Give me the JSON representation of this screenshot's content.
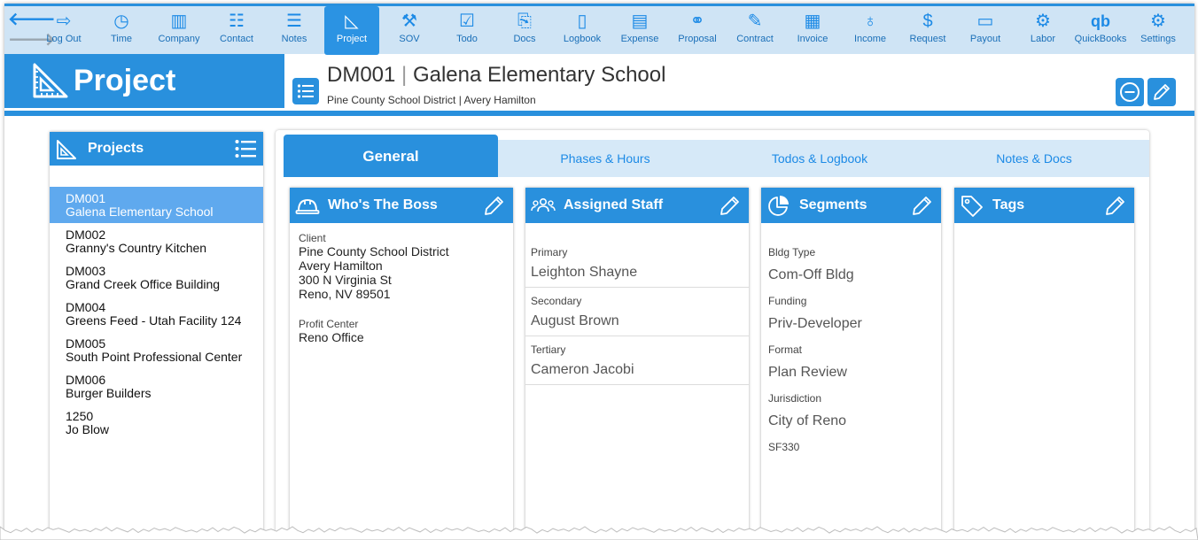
{
  "toolbar": {
    "items": [
      {
        "label": "Log Out",
        "icon": "log-out-icon",
        "glyph": "⇨"
      },
      {
        "label": "Time",
        "icon": "clock-icon",
        "glyph": "◷"
      },
      {
        "label": "Company",
        "icon": "building-icon",
        "glyph": "▥"
      },
      {
        "label": "Contact",
        "icon": "contact-card-icon",
        "glyph": "☷"
      },
      {
        "label": "Notes",
        "icon": "notes-icon",
        "glyph": "☰"
      },
      {
        "label": "Project",
        "icon": "triangle-ruler-icon",
        "glyph": "◺"
      },
      {
        "label": "SOV",
        "icon": "hammer-icon",
        "glyph": "⚒"
      },
      {
        "label": "Todo",
        "icon": "checklist-icon",
        "glyph": "☑"
      },
      {
        "label": "Docs",
        "icon": "documents-icon",
        "glyph": "⎘"
      },
      {
        "label": "Logbook",
        "icon": "logbook-icon",
        "glyph": "▯"
      },
      {
        "label": "Expense",
        "icon": "receipt-icon",
        "glyph": "▤"
      },
      {
        "label": "Proposal",
        "icon": "handshake-icon",
        "glyph": "⚭"
      },
      {
        "label": "Contract",
        "icon": "pen-icon",
        "glyph": "✎"
      },
      {
        "label": "Invoice",
        "icon": "invoice-icon",
        "glyph": "▦"
      },
      {
        "label": "Income",
        "icon": "piggy-bank-icon",
        "glyph": "♁"
      },
      {
        "label": "Request",
        "icon": "dollar-doc-icon",
        "glyph": "$"
      },
      {
        "label": "Payout",
        "icon": "check-icon",
        "glyph": "▭"
      },
      {
        "label": "Labor",
        "icon": "worker-icon",
        "glyph": "⚙"
      },
      {
        "label": "QuickBooks",
        "icon": "quickbooks-icon",
        "glyph": "qb"
      },
      {
        "label": "Settings",
        "icon": "gears-icon",
        "glyph": "⚙"
      }
    ],
    "active": "Project"
  },
  "brand": {
    "title": "Project",
    "icon": "triangle-ruler-icon"
  },
  "header": {
    "code": "DM001",
    "separator": "|",
    "name": "Galena Elementary School",
    "subtitle": "Pine County School District | Avery Hamilton"
  },
  "sidebar": {
    "title": "Projects",
    "items": [
      {
        "code": "DM001",
        "name": "Galena Elementary School",
        "selected": true
      },
      {
        "code": "DM002",
        "name": "Granny's Country Kitchen"
      },
      {
        "code": "DM003",
        "name": "Grand Creek Office Building"
      },
      {
        "code": "DM004",
        "name": "Greens Feed - Utah Facility 124"
      },
      {
        "code": "DM005",
        "name": "South Point Professional Center"
      },
      {
        "code": "DM006",
        "name": "Burger Builders"
      },
      {
        "code": "1250",
        "name": "Jo Blow"
      }
    ]
  },
  "tabs": [
    {
      "label": "General",
      "active": true
    },
    {
      "label": "Phases & Hours"
    },
    {
      "label": "Todos & Logbook"
    },
    {
      "label": "Notes & Docs"
    }
  ],
  "boss": {
    "title": "Who's The Boss",
    "client_label": "Client",
    "client_lines": [
      "Pine County School District",
      "Avery Hamilton",
      "300 N Virginia St",
      "Reno, NV 89501"
    ],
    "profit_label": "Profit Center",
    "profit_value": "Reno Office"
  },
  "staff": {
    "title": "Assigned Staff",
    "rows": [
      {
        "label": "Primary",
        "value": "Leighton Shayne"
      },
      {
        "label": "Secondary",
        "value": "August Brown"
      },
      {
        "label": "Tertiary",
        "value": "Cameron Jacobi"
      }
    ]
  },
  "segments": {
    "title": "Segments",
    "rows": [
      {
        "label": "Bldg Type",
        "value": "Com-Off Bldg"
      },
      {
        "label": "Funding",
        "value": "Priv-Developer"
      },
      {
        "label": "Format",
        "value": "Plan Review"
      },
      {
        "label": "Jurisdiction",
        "value": "City of Reno"
      },
      {
        "label": "SF330",
        "value": ""
      }
    ]
  },
  "tags": {
    "title": "Tags"
  },
  "colors": {
    "accent": "#2990dd",
    "toolbar_bg": "#cfe4f5",
    "selected_row": "#5fa9ee",
    "tab_bg": "#d6e9f8"
  }
}
